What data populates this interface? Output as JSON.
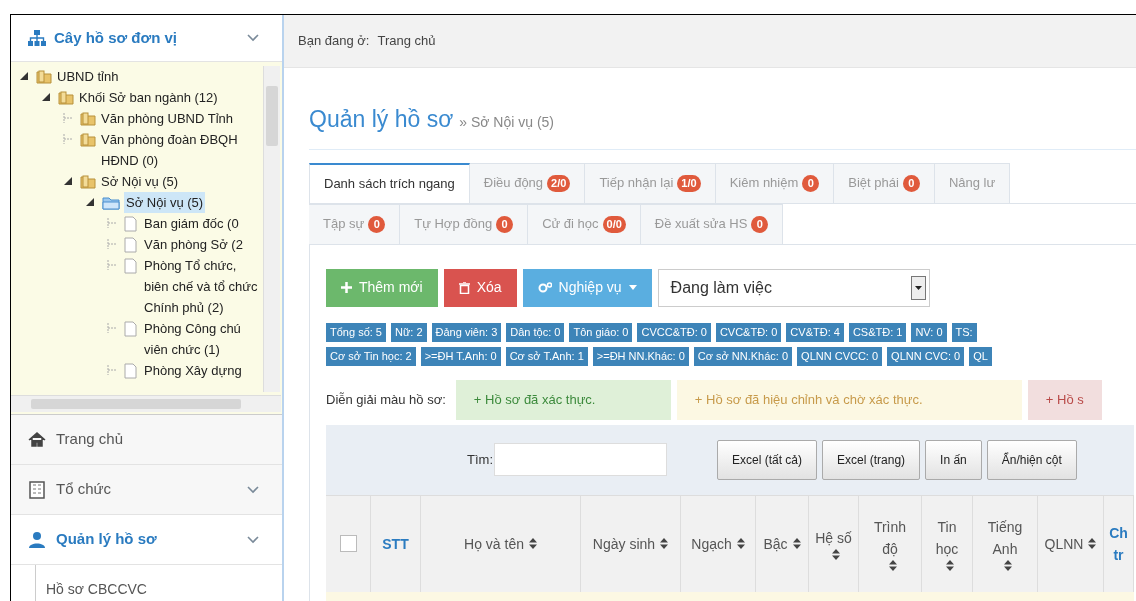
{
  "sidebar": {
    "header": {
      "title": "Cây hồ sơ đơn vị",
      "expanded": true
    },
    "tree": [
      {
        "label": "UBND tỉnh",
        "kind": "folder",
        "expanded": true,
        "selected": false,
        "children": [
          {
            "label": "Khối Sở ban ngành (12)",
            "kind": "folder",
            "expanded": true,
            "selected": false,
            "children": [
              {
                "label": "Văn phòng UBND Tỉnh",
                "kind": "folder",
                "selected": false
              },
              {
                "label": "Văn phòng đoàn ĐBQH HĐND (0)",
                "kind": "folder",
                "selected": false
              },
              {
                "label": "Sở Nội vụ (5)",
                "kind": "folder",
                "expanded": true,
                "selected": false,
                "children": [
                  {
                    "label": "Sở Nội vụ (5)",
                    "kind": "open-folder",
                    "expanded": true,
                    "selected": true,
                    "children": [
                      {
                        "label": "Ban giám đốc (0",
                        "kind": "file",
                        "selected": false
                      },
                      {
                        "label": "Văn phòng Sở (2",
                        "kind": "file",
                        "selected": false
                      },
                      {
                        "label": "Phòng Tổ chức, biên chế và tổ chức Chính phủ (2)",
                        "kind": "file",
                        "selected": false
                      },
                      {
                        "label": "Phòng Công chú viên chức (1)",
                        "kind": "file",
                        "selected": false
                      },
                      {
                        "label": "Phòng Xây dựng",
                        "kind": "file",
                        "selected": false
                      }
                    ]
                  }
                ]
              }
            ]
          }
        ]
      }
    ],
    "menu": [
      {
        "label": "Trang chủ",
        "kind": "home",
        "selected": false,
        "expandable": false
      },
      {
        "label": "Tổ chức",
        "kind": "building",
        "selected": false,
        "expandable": true
      },
      {
        "label": "Quản lý hồ sơ",
        "kind": "user",
        "selected": true,
        "expandable": true
      }
    ],
    "submenu": [
      {
        "label": "Hồ sơ CBCCVC"
      }
    ]
  },
  "breadcrumb": {
    "label": "Bạn đang ở:",
    "current": "Trang chủ"
  },
  "page": {
    "title": "Quản lý hồ sơ",
    "subtitle": "» Sở Nội vụ (5)"
  },
  "tab_rows": [
    [
      {
        "label": "Danh sách trích ngang",
        "selected": true
      },
      {
        "label": "Điều động",
        "count": "2/0",
        "selected": false
      },
      {
        "label": "Tiếp nhận lại",
        "count": "1/0",
        "selected": false
      },
      {
        "label": "Kiêm nhiệm",
        "count": "0",
        "selected": false
      },
      {
        "label": "Biệt phái",
        "count": "0",
        "selected": false
      },
      {
        "label": "Nâng lư",
        "selected": false
      }
    ],
    [
      {
        "label": "Tập sự",
        "count": "0",
        "selected": false
      },
      {
        "label": "Tự Hợp đồng",
        "count": "0",
        "selected": false
      },
      {
        "label": "Cử đi học",
        "count": "0/0",
        "selected": false
      },
      {
        "label": "Đề xuất sửa HS",
        "count": "0",
        "selected": false
      }
    ]
  ],
  "toolbar": {
    "buttons": [
      {
        "label": "Thêm mới",
        "kind": "add"
      },
      {
        "label": "Xóa",
        "kind": "delete"
      },
      {
        "label": "Nghiệp vụ",
        "kind": "menu"
      }
    ],
    "status_select": {
      "value": "Đang làm việc"
    }
  },
  "stats": [
    [
      "Tổng số: 5",
      "Nữ: 2",
      "Đảng viên: 3",
      "Dân tộc: 0",
      "Tôn giáo: 0",
      "CVCC&TĐ: 0",
      "CVC&TĐ: 0",
      "CV&TĐ: 4",
      "CS&TĐ: 1",
      "NV: 0",
      "TS:"
    ],
    [
      "Cơ sở Tin học: 2",
      ">=ĐH T.Anh: 0",
      "Cơ sở T.Anh: 1",
      ">=ĐH NN.Khác: 0",
      "Cơ sở NN.Khác: 0",
      "QLNN CVCC: 0",
      "QLNN CVC: 0",
      "QL"
    ]
  ],
  "legend": {
    "label": "Diễn giải màu hồ sơ:",
    "items": [
      {
        "label": "+ Hồ sơ đã xác thực.",
        "color": "#dff0d8"
      },
      {
        "label": "+ Hồ sơ đã hiệu chỉnh và chờ xác thực.",
        "color": "#fcf8e3"
      },
      {
        "label": "+ Hồ s",
        "color": "#f2dede"
      }
    ]
  },
  "table": {
    "search_label": "Tìm:",
    "buttons": [
      "Excel (tất cả)",
      "Excel (trang)",
      "In ấn",
      "Ẩn/hiện cột"
    ],
    "select_all_checked": false,
    "columns": [
      {
        "label": "STT",
        "sortable": false
      },
      {
        "label": "Họ và tên",
        "sortable": true
      },
      {
        "label": "Ngày sinh",
        "sortable": true
      },
      {
        "label": "Ngạch",
        "sortable": true
      },
      {
        "label": "Bậc",
        "sortable": true
      },
      {
        "label": "Hệ số",
        "sortable": true
      },
      {
        "label": "Trình độ",
        "sortable": true
      },
      {
        "label": "Tin học",
        "sortable": true
      },
      {
        "label": "Tiếng Anh",
        "sortable": true
      },
      {
        "label": "QLNN",
        "sortable": true
      },
      {
        "label": "Ch tr",
        "sortable": false
      }
    ],
    "rows": [
      {
        "color": "#fcf8e3"
      }
    ]
  }
}
